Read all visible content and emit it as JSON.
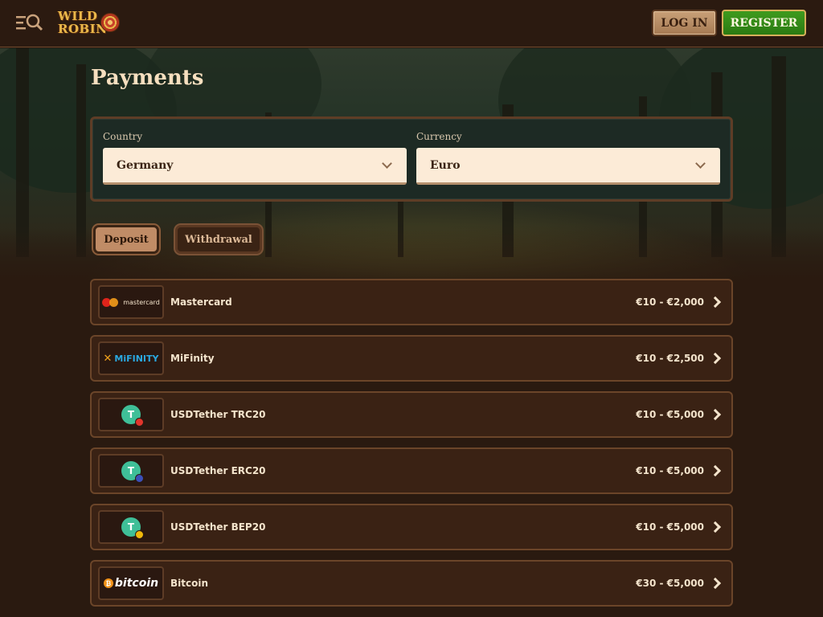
{
  "header": {
    "login_label": "LOG IN",
    "register_label": "REGISTER",
    "logo_line1": "WILD",
    "logo_line2": "ROBIN"
  },
  "page": {
    "title": "Payments"
  },
  "filters": {
    "country_label": "Country",
    "country_value": "Germany",
    "currency_label": "Currency",
    "currency_value": "Euro"
  },
  "tabs": [
    {
      "label": "Deposit",
      "active": true
    },
    {
      "label": "Withdrawal",
      "active": false
    }
  ],
  "methods": [
    {
      "name": "Mastercard",
      "range": "€10 - €2,000",
      "logo": "mastercard",
      "logo_text": "mastercard"
    },
    {
      "name": "MiFinity",
      "range": "€10 - €2,500",
      "logo": "mifinity",
      "logo_text": "MiFINITY"
    },
    {
      "name": "USDTether TRC20",
      "range": "€10 - €5,000",
      "logo": "tether-trc20"
    },
    {
      "name": "USDTether ERC20",
      "range": "€10 - €5,000",
      "logo": "tether-erc20"
    },
    {
      "name": "USDTether BEP20",
      "range": "€10 - €5,000",
      "logo": "tether-bep20"
    },
    {
      "name": "Bitcoin",
      "range": "€30 - €5,000",
      "logo": "bitcoin",
      "logo_text": "bitcoin"
    }
  ],
  "colors": {
    "background": "#2a1a10",
    "accent_green": "#3f9b1e",
    "card": "#3a2214",
    "panel": "#1d2a24"
  }
}
